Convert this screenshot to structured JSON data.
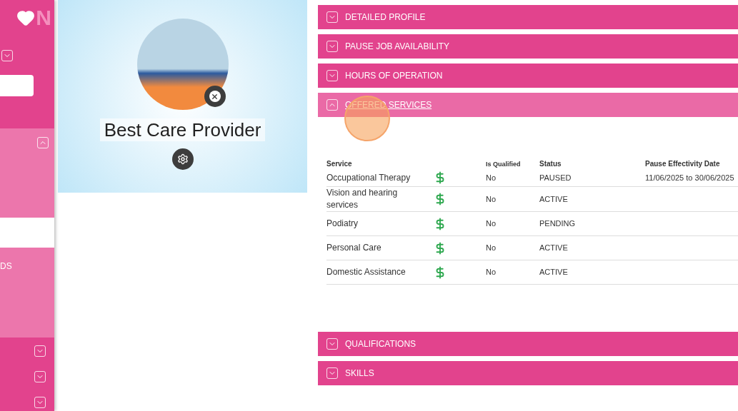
{
  "sidebar": {
    "logo_text": "N",
    "toggles": [
      {
        "expanded": false
      }
    ],
    "section": {
      "expanded": true
    },
    "partial_label": "DS",
    "bottom_toggles": [
      {
        "expanded": false
      },
      {
        "expanded": false
      },
      {
        "expanded": false
      }
    ]
  },
  "profile": {
    "name": "Best Care Provider"
  },
  "sections": [
    {
      "title": "DETAILED PROFILE",
      "expanded": false
    },
    {
      "title": "PAUSE JOB AVAILABILITY",
      "expanded": false
    },
    {
      "title": "HOURS OF OPERATION",
      "expanded": false
    },
    {
      "title": "OFFERED SERVICES",
      "expanded": true,
      "table": {
        "columns": [
          "Service",
          "Is Qualified",
          "Status",
          "Pause Effectivity Date"
        ],
        "rows": [
          {
            "service": "Occupational Therapy",
            "paid": true,
            "qualified": "No",
            "status": "PAUSED",
            "pause_date": "11/06/2025 to 30/06/2025"
          },
          {
            "service": "Vision and hearing services",
            "paid": true,
            "qualified": "No",
            "status": "ACTIVE"
          },
          {
            "service": "Podiatry",
            "paid": true,
            "qualified": "No",
            "status": "PENDING"
          },
          {
            "service": "Personal Care",
            "paid": true,
            "qualified": "No",
            "status": "ACTIVE"
          },
          {
            "service": "Domestic Assistance",
            "paid": true,
            "qualified": "No",
            "status": "ACTIVE"
          }
        ]
      }
    },
    {
      "title": "QUALIFICATIONS",
      "expanded": false
    },
    {
      "title": "SKILLS",
      "expanded": false
    }
  ]
}
